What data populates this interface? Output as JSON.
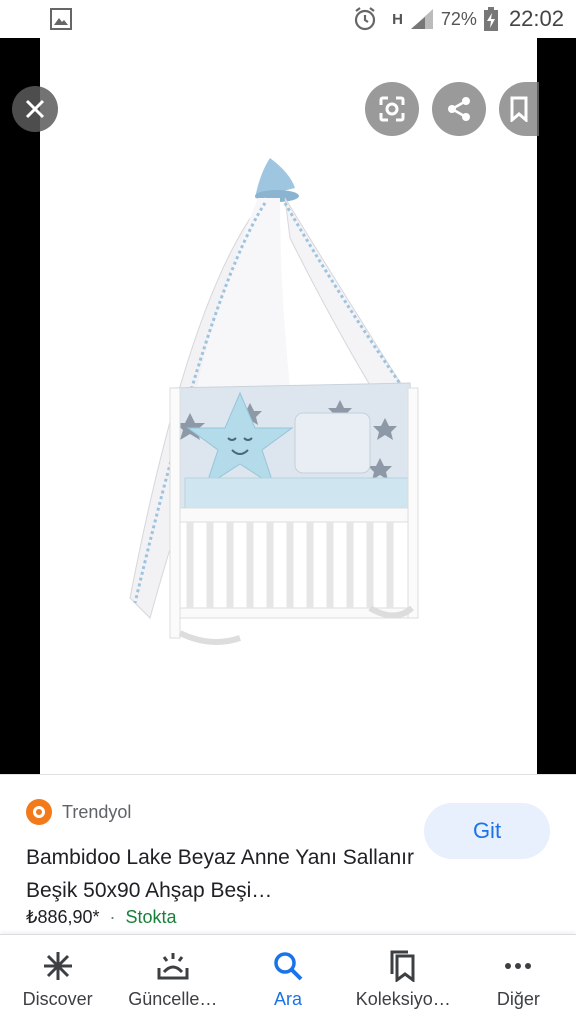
{
  "status_bar": {
    "battery": "72%",
    "time": "22:02",
    "network": "H"
  },
  "viewer": {
    "buttons": [
      "close-icon",
      "lens-icon",
      "share-icon",
      "bookmark-icon"
    ]
  },
  "result": {
    "source": "Trendyol",
    "title": "Bambidoo Lake Beyaz Anne Yanı Sallanır Beşik 50x90 Ahşap Beşi…",
    "price": "₺886,90*",
    "separator": "·",
    "stock": "Stokta",
    "visit_label": "Git"
  },
  "bottom_nav": {
    "items": [
      {
        "label": "Discover",
        "icon": "asterisk-icon"
      },
      {
        "label": "Güncelle…",
        "icon": "updates-icon"
      },
      {
        "label": "Ara",
        "icon": "search-icon"
      },
      {
        "label": "Koleksiyo…",
        "icon": "collections-icon"
      },
      {
        "label": "Diğer",
        "icon": "more-icon"
      }
    ],
    "active": "Ara"
  },
  "colors": {
    "accent": "#1a73e8",
    "stock_green": "#188038",
    "source_orange": "#f27a1a"
  }
}
